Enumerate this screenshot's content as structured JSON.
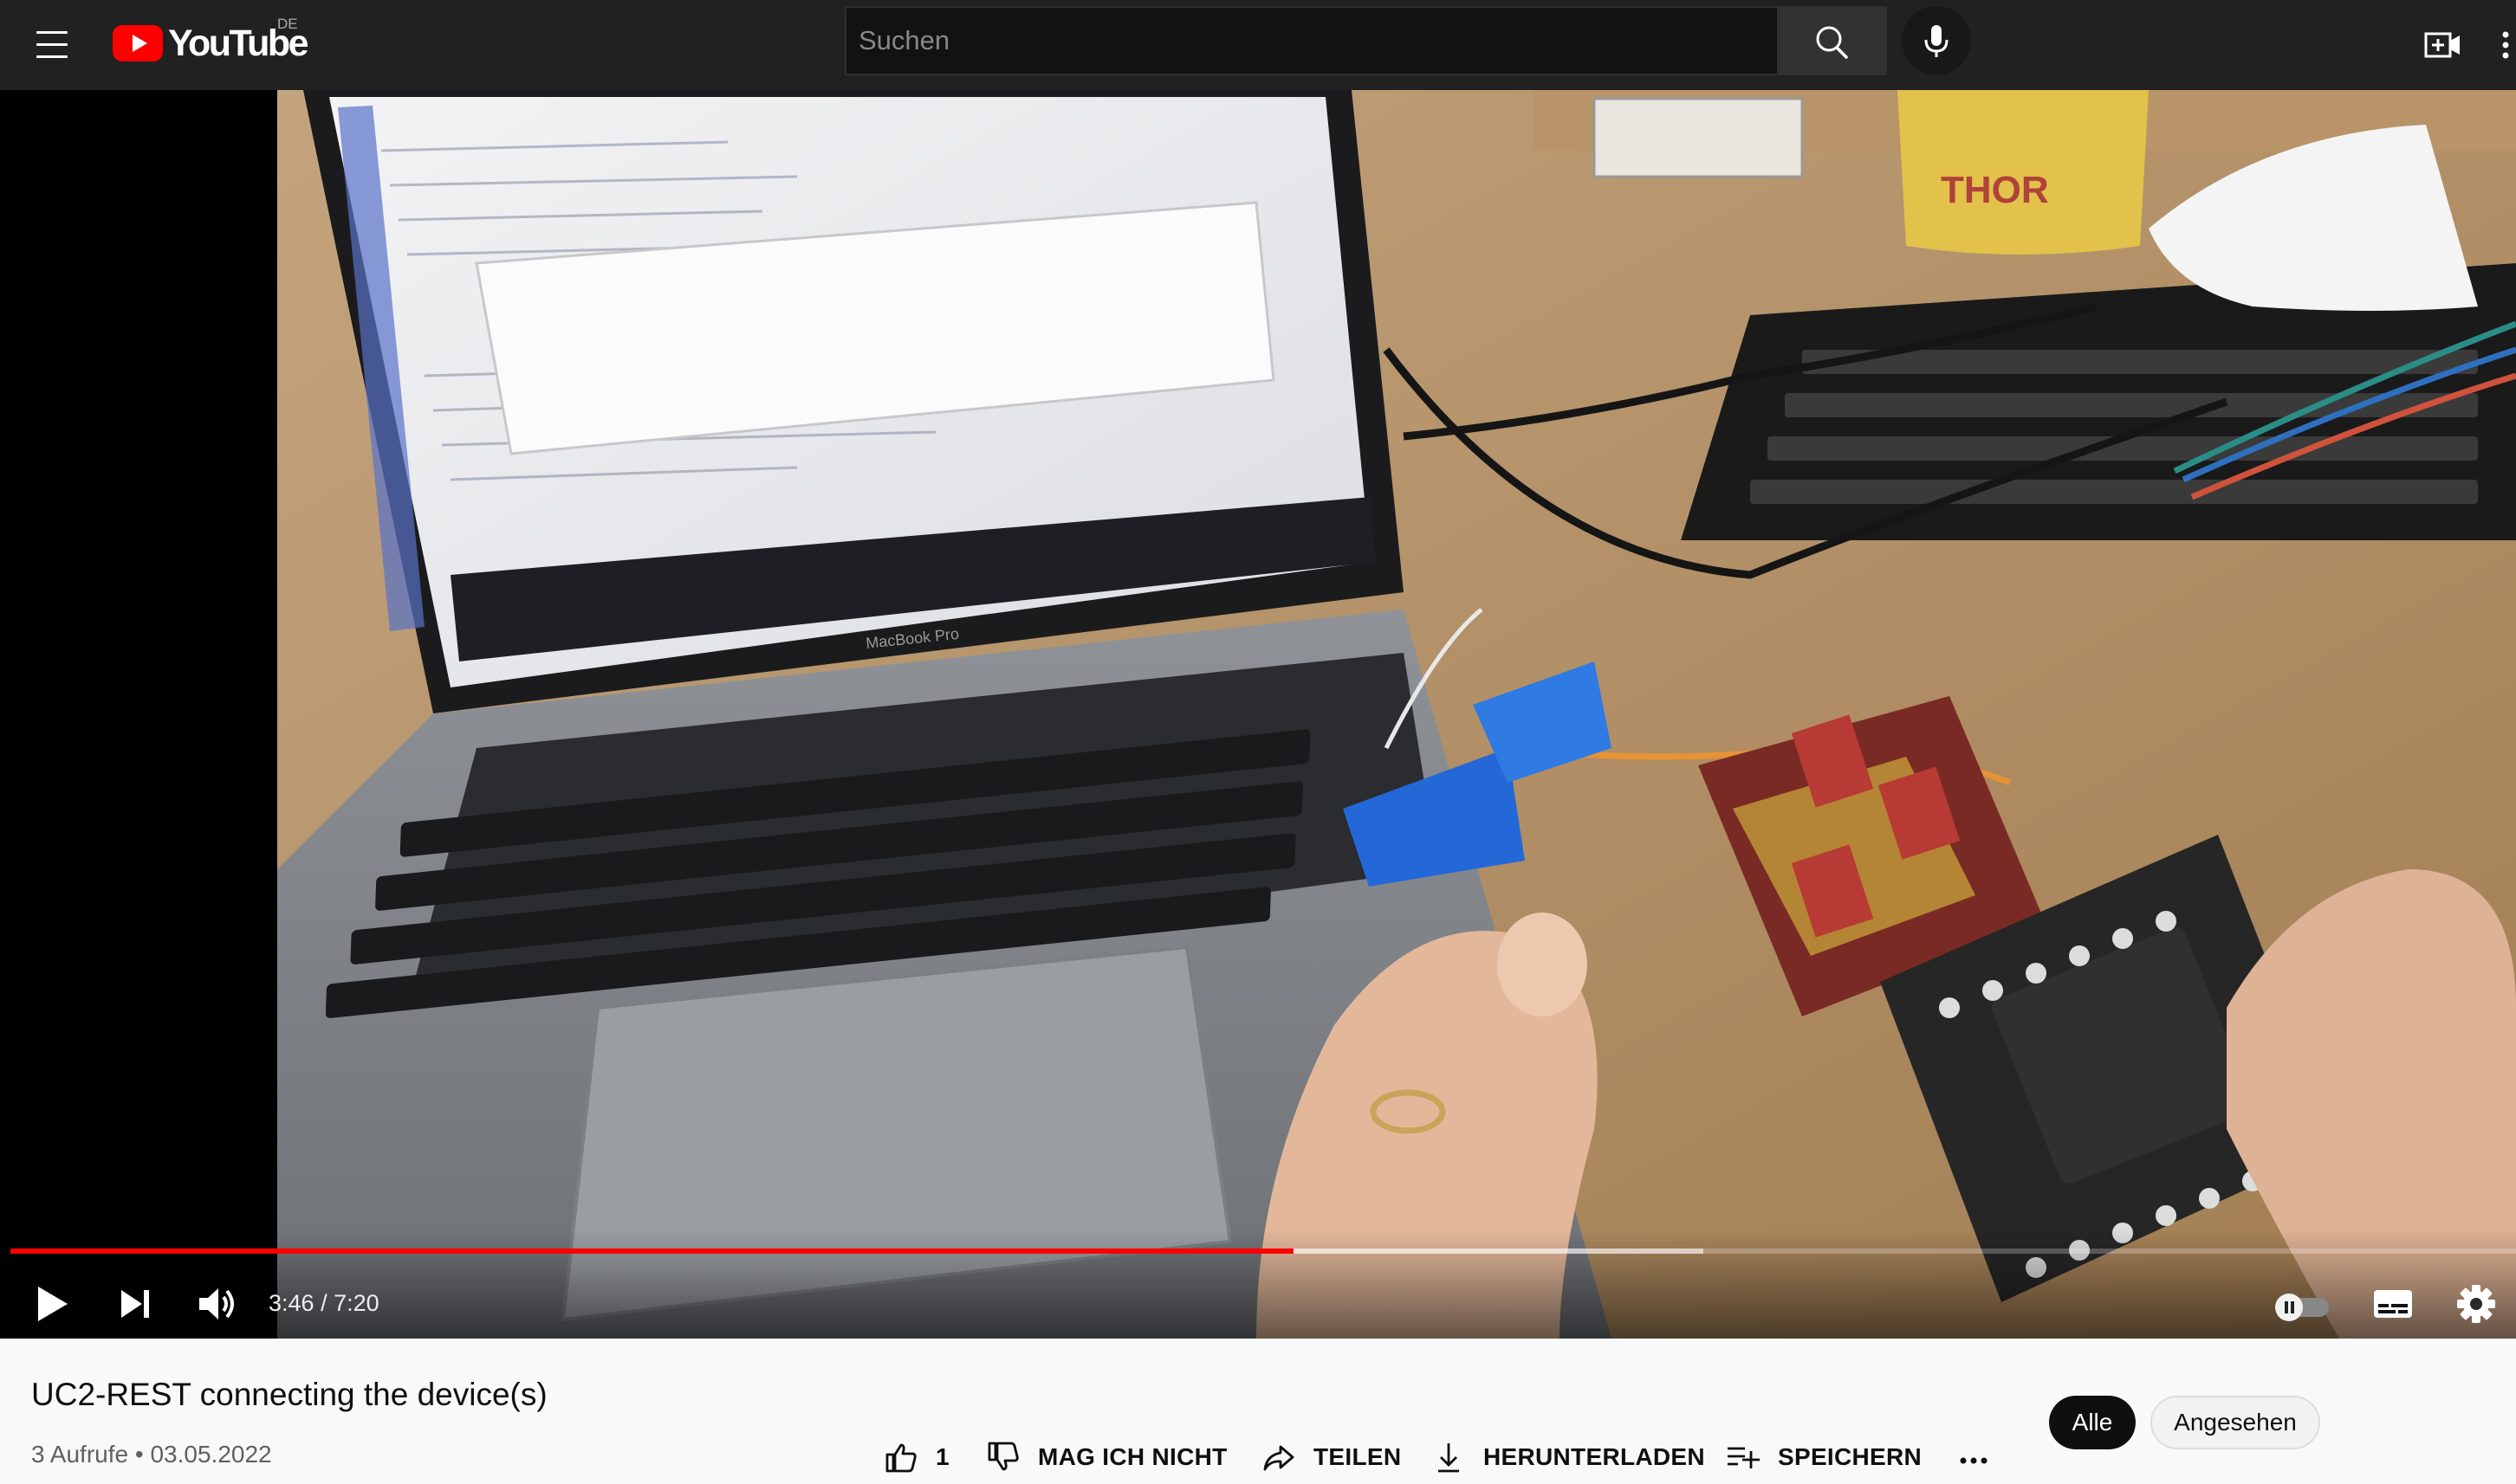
{
  "masthead": {
    "logo_text": "YouTube",
    "country_code": "DE",
    "search_placeholder": "Suchen"
  },
  "player": {
    "current_time": "3:46",
    "duration": "7:20",
    "progress_fraction": 0.5122,
    "buffered_fraction": 0.6757,
    "laptop_brand_text": "MacBook Pro"
  },
  "video": {
    "title": "UC2-REST connecting the device(s)",
    "views": "3 Aufrufe",
    "separator": "•",
    "date": "03.05.2022"
  },
  "actions": {
    "like_count": "1",
    "dislike_label": "MAG ICH NICHT",
    "share_label": "TEILEN",
    "download_label": "HERUNTERLADEN",
    "save_label": "SPEICHERN"
  },
  "chips": [
    {
      "label": "Alle",
      "active": true
    },
    {
      "label": "Angesehen",
      "active": false
    }
  ],
  "colors": {
    "brand_red": "#ff0000",
    "masthead_bg": "#212121",
    "progress_played": "#ff0000"
  }
}
